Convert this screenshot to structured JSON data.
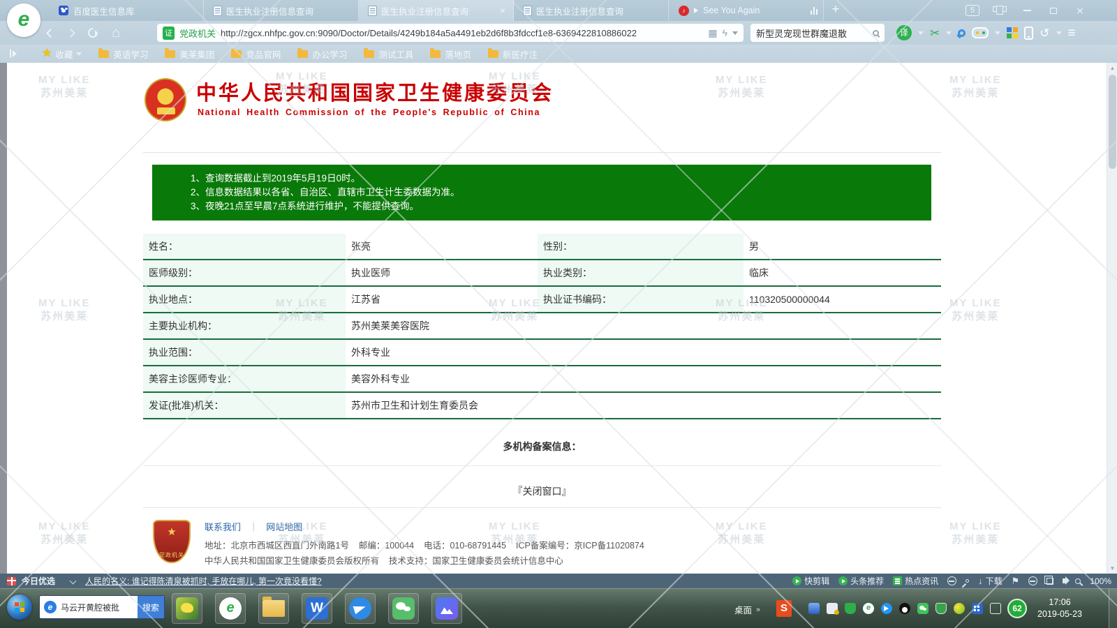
{
  "browser": {
    "tabs": [
      {
        "label": "百度医生信息库"
      },
      {
        "label": "医生执业注册信息查询"
      },
      {
        "label": "医生执业注册信息查询"
      },
      {
        "label": "医生执业注册信息查询"
      },
      {
        "label": "See You Again"
      }
    ],
    "new_tab": "+",
    "tab_count": "5",
    "address": {
      "cert_badge": "证",
      "site_type": "党政机关",
      "url": "http://zgcx.nhfpc.gov.cn:9090/Doctor/Details/4249b184a5a4491eb2d6f8b3fdccf1e8-6369422810886022"
    },
    "quick_search": {
      "value": "新型灵宠现世群魔退散"
    },
    "toolbar": {
      "translate": "译"
    },
    "bookmarks": {
      "fav": "收藏",
      "folders": [
        "英语学习",
        "美莱集团",
        "竞品官网",
        "办公学习",
        "测试工具",
        "落地页",
        "新医疗注"
      ]
    }
  },
  "page": {
    "header": {
      "title_cn": "中华人民共和国国家卫生健康委员会",
      "title_en": "National Health Commission of the People's Republic of China"
    },
    "notice_lines": [
      "1、查询数据截止到2019年5月19日0时。",
      "2、信息数据结果以各省、自治区、直辖市卫生计生委数据为准。",
      "3、夜晚21点至早晨7点系统进行维护，不能提供查询。"
    ],
    "table": {
      "row1": {
        "l1": "姓名：",
        "v1": "张亮",
        "l2": "性别：",
        "v2": "男"
      },
      "row2": {
        "l1": "医师级别：",
        "v1": "执业医师",
        "l2": "执业类别：",
        "v2": "临床"
      },
      "row3": {
        "l1": "执业地点：",
        "v1": "江苏省",
        "l2": "执业证书编码：",
        "v2": "110320500000044"
      },
      "row4": {
        "l": "主要执业机构：",
        "v": "苏州美莱美容医院"
      },
      "row5": {
        "l": "执业范围：",
        "v": "外科专业"
      },
      "row6": {
        "l": "美容主诊医师专业：",
        "v": "美容外科专业"
      },
      "row7": {
        "l": "发证(批准)机关：",
        "v": "苏州市卫生和计划生育委员会"
      }
    },
    "multi_org": "多机构备案信息：",
    "close_window": "『关闭窗口』",
    "footer": {
      "link1": "联系我们",
      "sep": "｜",
      "link2": "网站地图",
      "line1": "地址：北京市西城区西直门外南路1号    邮编：100044    电话：010-68791445    ICP备案编号：京ICP备11020874",
      "line2": "中华人民共和国国家卫生健康委员会版权所有    技术支持：国家卫生健康委员会统计信息中心"
    },
    "watermark": {
      "line1": "MY LIKE",
      "line2": "苏州美莱"
    }
  },
  "statusbar": {
    "left": {
      "brand": "今日优选",
      "news": "人民的名义: 谁记得陈清泉被抓时, 手放在哪儿, 第一次竟没看懂?"
    },
    "right": {
      "clip": "快剪辑",
      "toutiao": "头条推荐",
      "hot": "热点资讯",
      "download": "下载",
      "zoom": "100%"
    }
  },
  "taskbar": {
    "search": {
      "value": "马云开黄腔被批",
      "button": "搜索"
    },
    "desktop": "桌面",
    "s_badge": "S",
    "badge62": "62",
    "clock": {
      "time": "17:06",
      "date": "2019-05-23"
    }
  }
}
